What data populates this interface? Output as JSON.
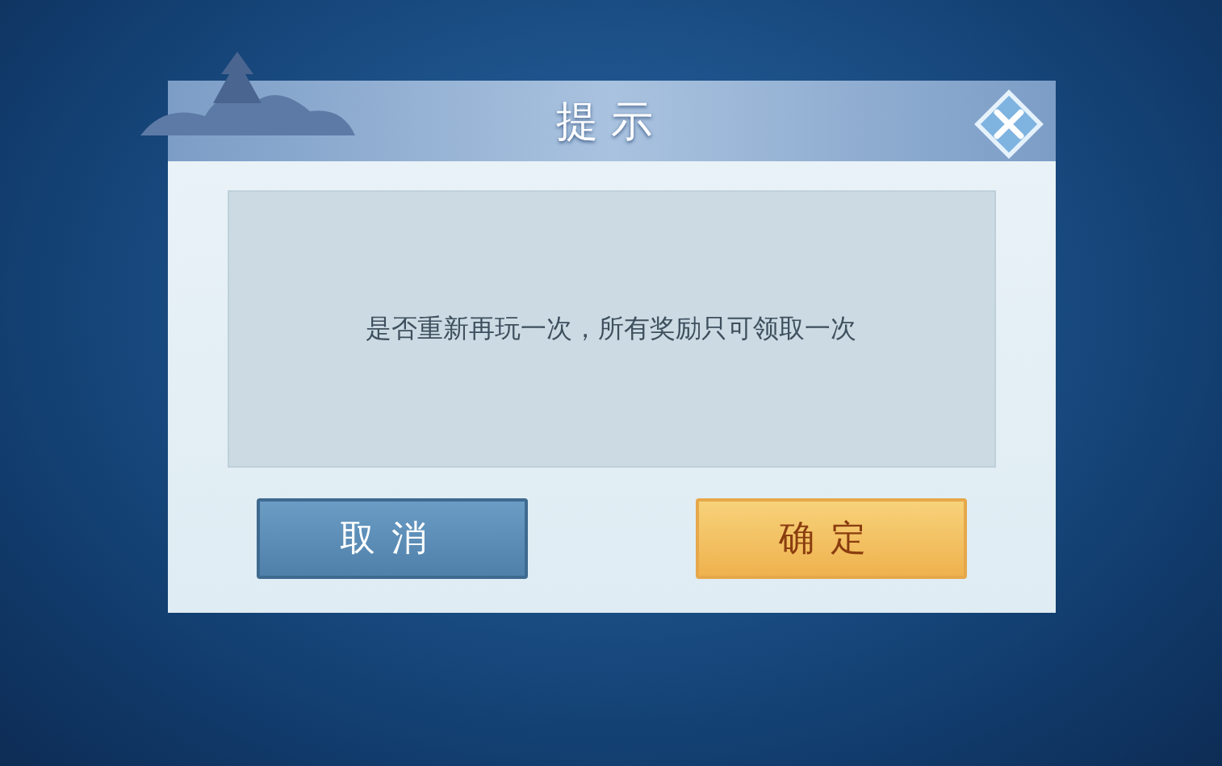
{
  "dialog": {
    "title": "提示",
    "message": "是否重新再玩一次，所有奖励只可领取一次",
    "buttons": [
      {
        "label": "取消",
        "kind": "secondary"
      },
      {
        "label": "确定",
        "kind": "primary"
      }
    ]
  }
}
